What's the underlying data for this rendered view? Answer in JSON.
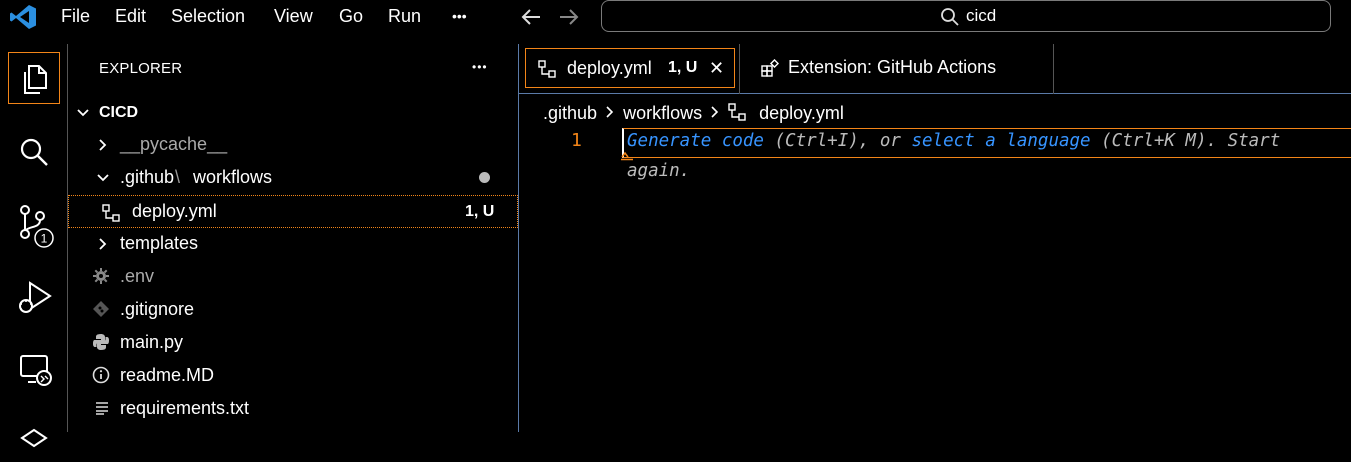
{
  "menu": [
    "File",
    "Edit",
    "Selection",
    "View",
    "Go",
    "Run",
    "•••"
  ],
  "search": {
    "text": "cicd"
  },
  "activity": {
    "source_control_badge": "1"
  },
  "sidebar": {
    "title": "EXPLORER",
    "more": "•••",
    "root": "CICD",
    "items": [
      {
        "label": "__pycache__",
        "kind": "folder-collapsed"
      },
      {
        "label": ".github",
        "label2": "workflows",
        "kind": "folder-expanded"
      },
      {
        "label": "deploy.yml",
        "status": "1, U",
        "kind": "yml"
      },
      {
        "label": "templates",
        "kind": "folder-collapsed"
      },
      {
        "label": ".env",
        "kind": "gear"
      },
      {
        "label": ".gitignore",
        "kind": "git"
      },
      {
        "label": "main.py",
        "kind": "python"
      },
      {
        "label": "readme.MD",
        "kind": "info"
      },
      {
        "label": "requirements.txt",
        "kind": "lines"
      }
    ]
  },
  "tabs": [
    {
      "label": "deploy.yml",
      "badge": "1, U",
      "close": "✕"
    },
    {
      "label": "Extension: GitHub Actions"
    }
  ],
  "breadcrumb": {
    "part1": ".github",
    "part2": "workflows",
    "part3": "deploy.yml"
  },
  "editor": {
    "line_number": "1",
    "hint1_kw": "Generate code",
    "hint1_rest": " (Ctrl+I), or ",
    "hint2_kw": "select a language",
    "hint2_rest": " (Ctrl+K M). Start",
    "hint3": "again."
  },
  "colors": {
    "accent": "#f38518",
    "link": "#3794ff",
    "divider": "#5a7aa8"
  }
}
